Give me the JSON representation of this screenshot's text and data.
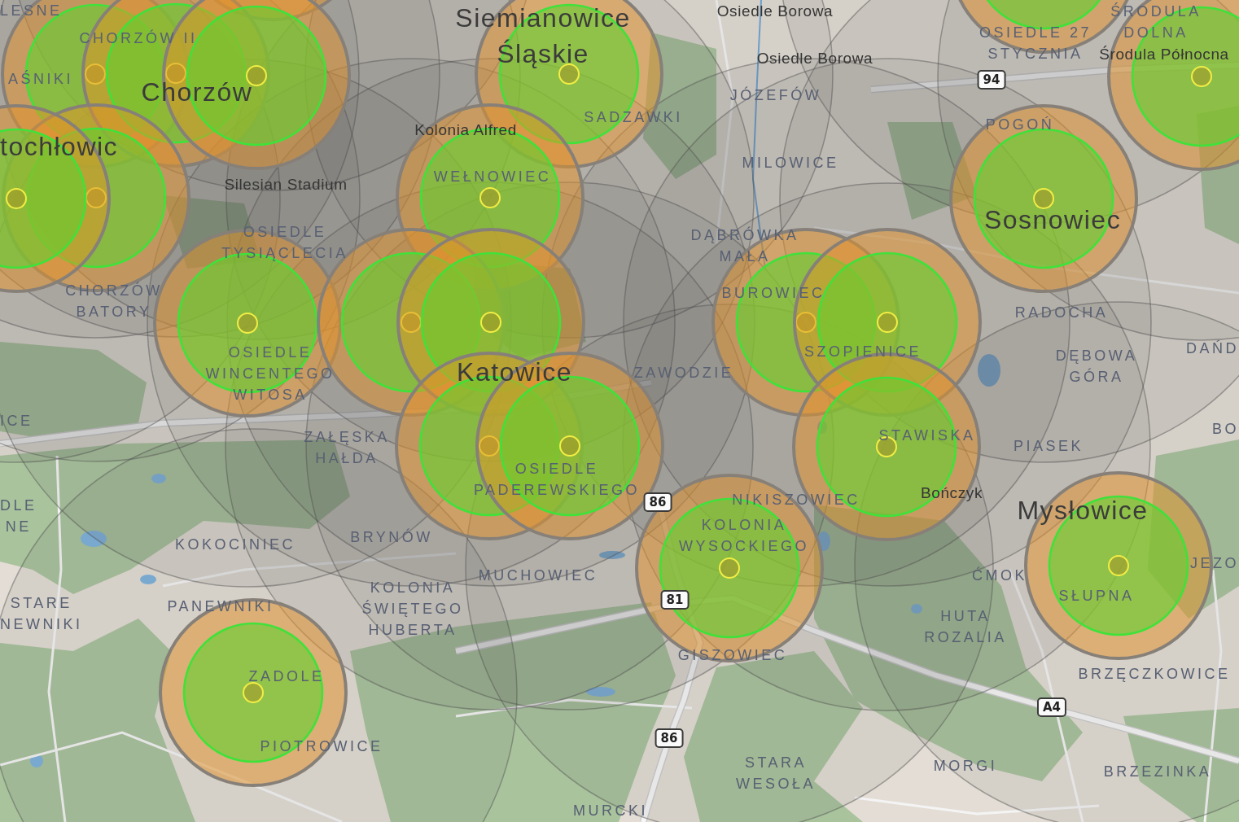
{
  "map": {
    "place_labels": [
      {
        "text": "LESNE",
        "kind": "district"
      },
      {
        "text": "Siemianowice\nŚląskie",
        "kind": "city"
      },
      {
        "text": "Osiedle Borowa",
        "kind": "locality"
      },
      {
        "text": "CHORZÓW II",
        "kind": "district"
      },
      {
        "text": "Osiedle Borowa",
        "kind": "locality"
      },
      {
        "text": "OSIEDLE 27\nSTYCZNIA",
        "kind": "district"
      },
      {
        "text": "ŚRODULA\nDOLNA",
        "kind": "district"
      },
      {
        "text": "Środula Północna",
        "kind": "locality"
      },
      {
        "text": "AŚNIKI",
        "kind": "district"
      },
      {
        "text": "Chorzów",
        "kind": "city"
      },
      {
        "text": "JÓZEFÓW",
        "kind": "district"
      },
      {
        "text": "tochłowic",
        "kind": "city"
      },
      {
        "text": "Silesian Stadium",
        "kind": "locality"
      },
      {
        "text": "Kolonia Alfred",
        "kind": "locality"
      },
      {
        "text": "WEŁNOWIEC",
        "kind": "district"
      },
      {
        "text": "SADZAWKI",
        "kind": "district"
      },
      {
        "text": "MILOWICE",
        "kind": "district"
      },
      {
        "text": "POGOŃ",
        "kind": "district"
      },
      {
        "text": "OSIEDLE\nTYSIĄCLECIA",
        "kind": "district"
      },
      {
        "text": "DĄBRÓWKA\nMAŁA",
        "kind": "district"
      },
      {
        "text": "Sosnowiec",
        "kind": "city"
      },
      {
        "text": "CHORZÓW\nBATORY",
        "kind": "district"
      },
      {
        "text": "BUROWIEC",
        "kind": "district"
      },
      {
        "text": "RADOCHA",
        "kind": "district"
      },
      {
        "text": "OSIEDLE\nWINCENTEGO\nWITOSA",
        "kind": "district"
      },
      {
        "text": "Katowice",
        "kind": "city"
      },
      {
        "text": "ZAWODZIE",
        "kind": "district"
      },
      {
        "text": "SZOPIENICE",
        "kind": "district"
      },
      {
        "text": "DĘBOWA\nGÓRA",
        "kind": "district"
      },
      {
        "text": "DAŃD",
        "kind": "district"
      },
      {
        "text": "ICE",
        "kind": "district"
      },
      {
        "text": "ZAŁĘSKA\nHAŁDA",
        "kind": "district"
      },
      {
        "text": "STAWISKA",
        "kind": "district"
      },
      {
        "text": "PIASEK",
        "kind": "district"
      },
      {
        "text": "BO",
        "kind": "district"
      },
      {
        "text": "DLE\nNE",
        "kind": "district"
      },
      {
        "text": "OSIEDLE\nPADEREWSKIEGO",
        "kind": "district"
      },
      {
        "text": "NIKISZOWIEC",
        "kind": "district"
      },
      {
        "text": "Bończyk",
        "kind": "locality"
      },
      {
        "text": "KOKOCINIEC",
        "kind": "district"
      },
      {
        "text": "BRYNÓW",
        "kind": "district"
      },
      {
        "text": "KOLONIA\nWYSOCKIEGO",
        "kind": "district"
      },
      {
        "text": "Mysłowice",
        "kind": "city"
      },
      {
        "text": "STARE\nNEWNIKI",
        "kind": "district"
      },
      {
        "text": "PANEWNIKI",
        "kind": "district"
      },
      {
        "text": "KOLONIA\nŚWIĘTEGO\nHUBERTA",
        "kind": "district"
      },
      {
        "text": "MUCHOWIEC",
        "kind": "district"
      },
      {
        "text": "ĆMOK",
        "kind": "district"
      },
      {
        "text": "HUTA\nROZALIA",
        "kind": "district"
      },
      {
        "text": "SŁUPNA",
        "kind": "district"
      },
      {
        "text": "JEZO",
        "kind": "district"
      },
      {
        "text": "ZADOLE",
        "kind": "district"
      },
      {
        "text": "GISZOWIEC",
        "kind": "district"
      },
      {
        "text": "BRZĘCZKOWICE",
        "kind": "district"
      },
      {
        "text": "PIOTROWICE",
        "kind": "district"
      },
      {
        "text": "STARA\nWESOŁA",
        "kind": "district"
      },
      {
        "text": "MORGI",
        "kind": "district"
      },
      {
        "text": "BRZEZINKA",
        "kind": "district"
      },
      {
        "text": "MURCKI",
        "kind": "district"
      }
    ],
    "road_shields": [
      {
        "text": "94"
      },
      {
        "text": "86"
      },
      {
        "text": "81"
      },
      {
        "text": "A4"
      },
      {
        "text": "86"
      }
    ]
  }
}
